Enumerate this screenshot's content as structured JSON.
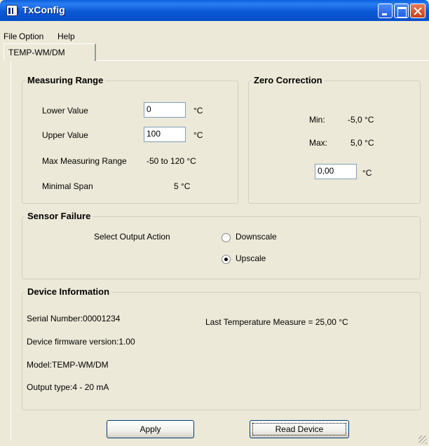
{
  "window": {
    "title": "TxConfig",
    "icon": "app-icon",
    "controls": [
      "minimize-icon",
      "maximize-icon",
      "close-icon"
    ]
  },
  "menu": {
    "file": "File",
    "option": "Option",
    "help": "Help"
  },
  "tabs": [
    {
      "label": "TEMP-WM/DM",
      "active": true
    }
  ],
  "measuring_range": {
    "title": "Measuring Range",
    "lower_label": "Lower Value",
    "lower_value": "0",
    "lower_unit": "°C",
    "upper_label": "Upper Value",
    "upper_value": "100",
    "upper_unit": "°C",
    "max_range_label": "Max Measuring Range",
    "max_range_value": "-50 to 120 °C",
    "min_span_label": "Minimal Span",
    "min_span_value": "5 °C"
  },
  "zero_correction": {
    "title": "Zero Correction",
    "min_label": "Min:",
    "min_value": "-5,0 °C",
    "max_label": "Max:",
    "max_value": "5,0 °C",
    "value": "0,00",
    "unit": "°C"
  },
  "sensor_failure": {
    "title": "Sensor Failure",
    "select_label": "Select Output Action",
    "options": [
      {
        "label": "Downscale",
        "selected": false
      },
      {
        "label": "Upscale",
        "selected": true
      }
    ]
  },
  "device_info": {
    "title": "Device Information",
    "serial": "Serial Number:00001234",
    "firmware": "Device firmware version:1.00",
    "model": "Model:TEMP-WM/DM",
    "output": "Output type:4 - 20 mA",
    "last_temp": "Last Temperature Measure = 25,00 °C"
  },
  "buttons": {
    "apply": "Apply",
    "read": "Read Device"
  },
  "colors": {
    "titlebar": "#0a5fde",
    "window_bg": "#ece9d8",
    "group_border": "#d0d0bf",
    "field_border": "#7f9db9"
  }
}
